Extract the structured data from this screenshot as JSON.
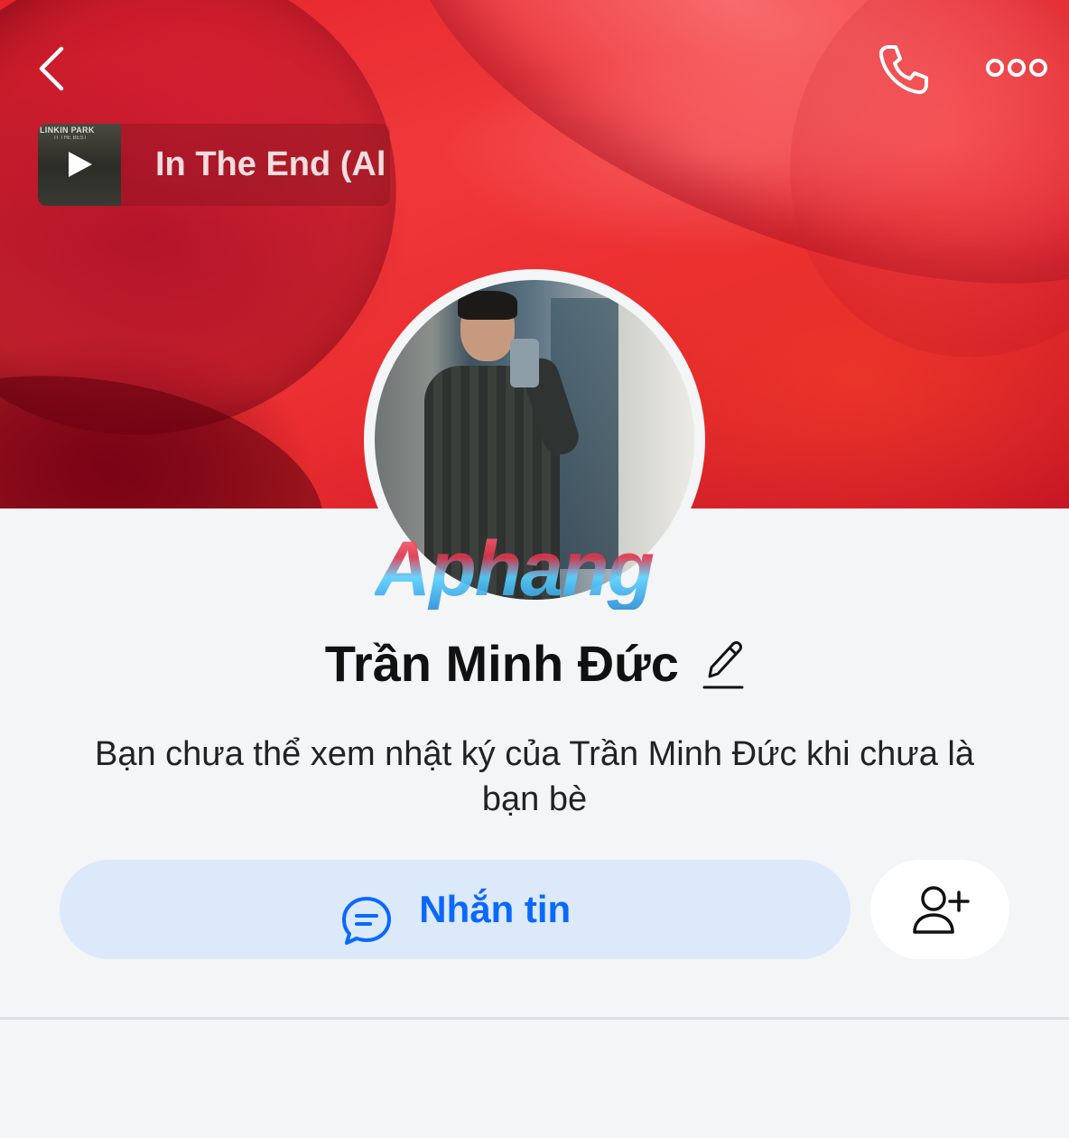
{
  "header": {
    "back_icon": "chevron-left-icon",
    "call_icon": "phone-icon",
    "more_icon": "more-horizontal-icon"
  },
  "music": {
    "album_title": "LINKIN PARK",
    "album_subtitle": "IT THE BEST",
    "song_title": "In The End (Al",
    "play_icon": "play-icon"
  },
  "watermark": "Aphang",
  "profile": {
    "name": "Trần Minh Đức",
    "edit_icon": "pencil-icon",
    "notice": "Bạn chưa thể xem nhật ký của Trần Minh Đức khi chưa là bạn bè"
  },
  "actions": {
    "message_label": "Nhắn tin",
    "message_icon": "chat-bubble-icon",
    "add_friend_icon": "add-user-icon"
  },
  "colors": {
    "accent": "#0a68ff",
    "message_button_bg": "#dbe9fa",
    "page_bg": "#f3f5f7"
  }
}
